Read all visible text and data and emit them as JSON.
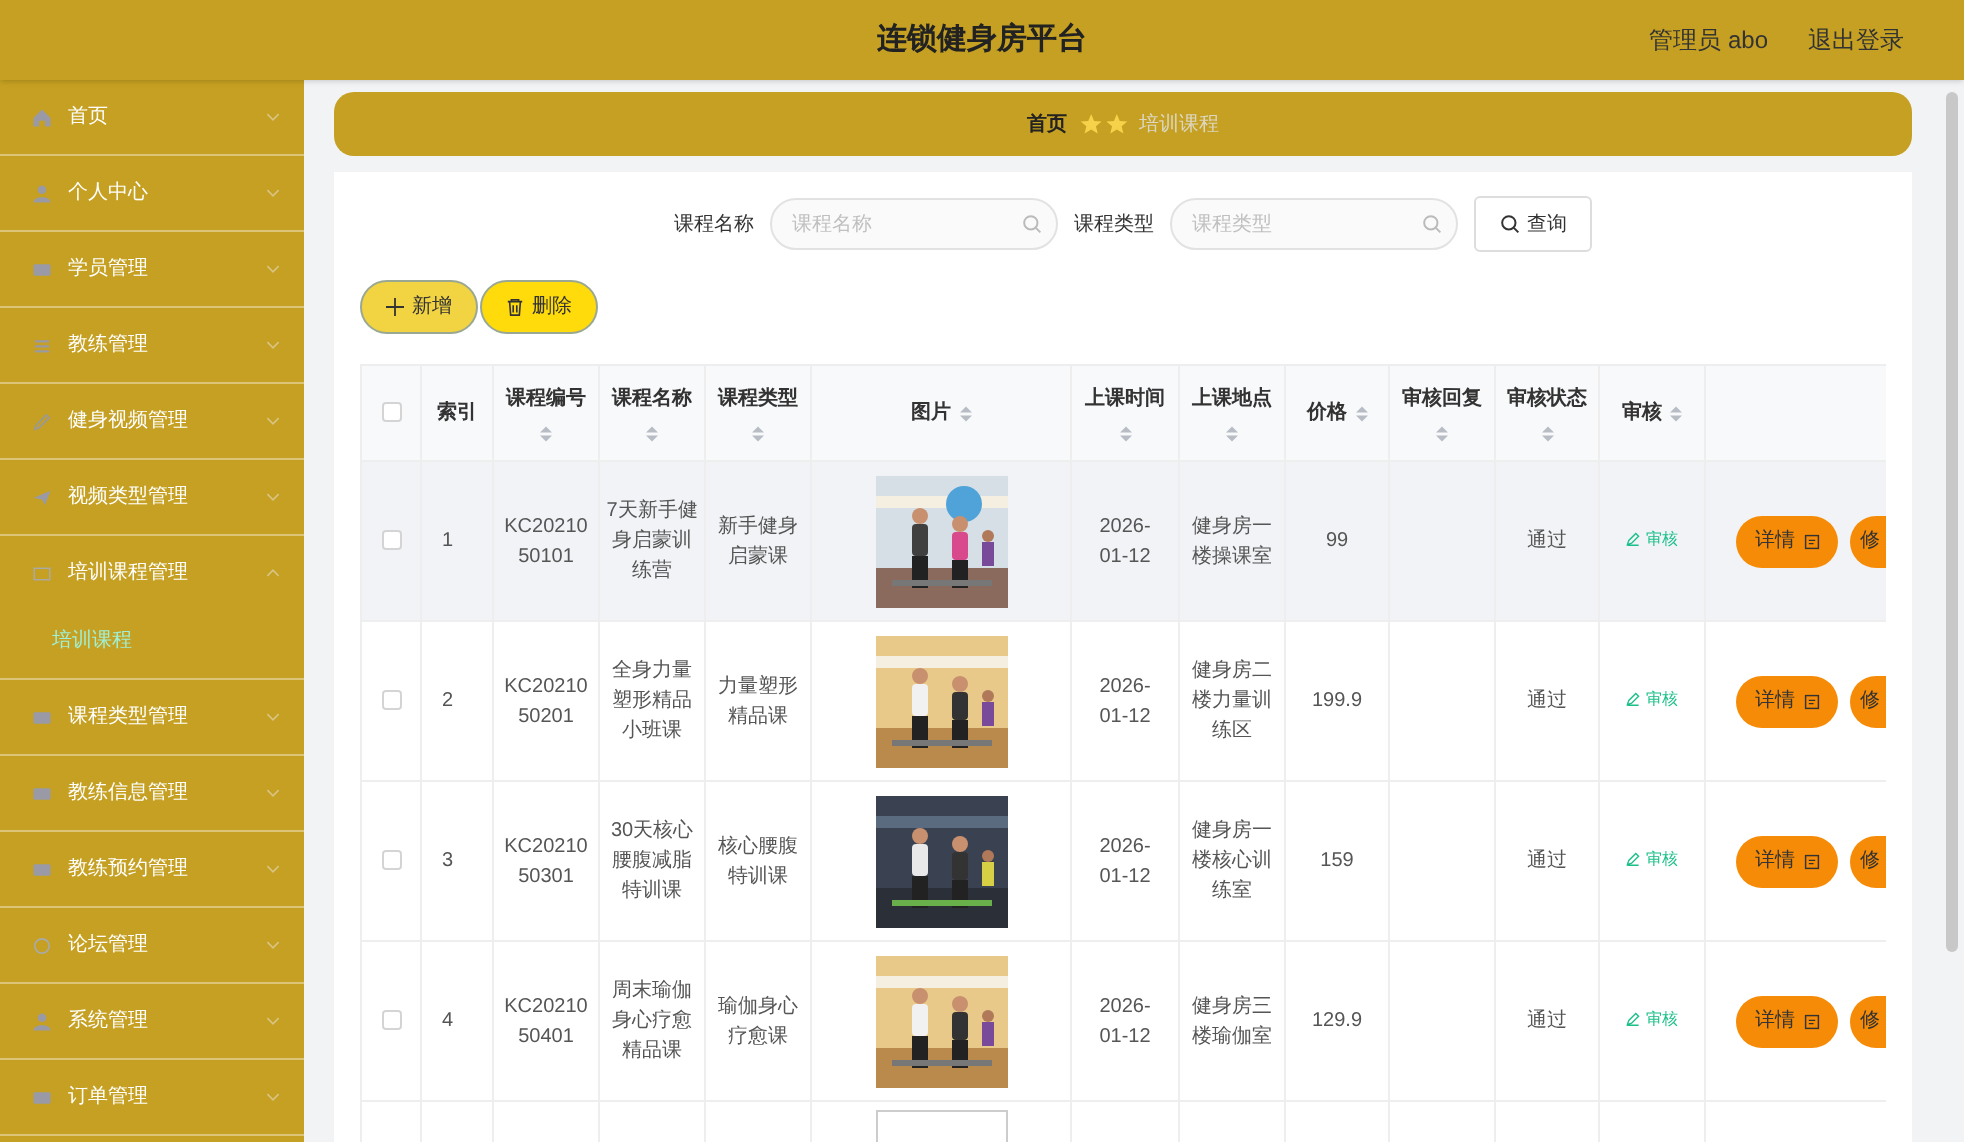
{
  "header": {
    "title": "连锁健身房平台",
    "user": "管理员 abo",
    "logout": "退出登录"
  },
  "sidebar": {
    "items": [
      {
        "label": "首页",
        "expanded": false
      },
      {
        "label": "个人中心",
        "expanded": false
      },
      {
        "label": "学员管理",
        "expanded": false
      },
      {
        "label": "教练管理",
        "expanded": false
      },
      {
        "label": "健身视频管理",
        "expanded": false
      },
      {
        "label": "视频类型管理",
        "expanded": false
      },
      {
        "label": "培训课程管理",
        "expanded": true,
        "children": [
          {
            "label": "培训课程",
            "selected": true
          }
        ]
      },
      {
        "label": "课程类型管理",
        "expanded": false
      },
      {
        "label": "教练信息管理",
        "expanded": false
      },
      {
        "label": "教练预约管理",
        "expanded": false
      },
      {
        "label": "论坛管理",
        "expanded": false
      },
      {
        "label": "系统管理",
        "expanded": false
      },
      {
        "label": "订单管理",
        "expanded": false
      }
    ]
  },
  "breadcrumb": [
    {
      "label": "首页",
      "current": false
    },
    {
      "label": "培训课程",
      "current": true
    }
  ],
  "search": {
    "fields": [
      {
        "label": "课程名称",
        "placeholder": "课程名称"
      },
      {
        "label": "课程类型",
        "placeholder": "课程类型"
      }
    ],
    "button": "查询"
  },
  "actions": [
    {
      "label": "新增",
      "kind": "add"
    },
    {
      "label": "删除",
      "kind": "delete"
    }
  ],
  "table": {
    "all_checked": false,
    "columns": [
      {
        "label": "索引",
        "sortable": false
      },
      {
        "label": "课程编号",
        "sortable": true
      },
      {
        "label": "课程名称",
        "sortable": true
      },
      {
        "label": "课程类型",
        "sortable": true
      },
      {
        "label": "图片",
        "sortable": true
      },
      {
        "label": "上课时间",
        "sortable": true
      },
      {
        "label": "上课地点",
        "sortable": true
      },
      {
        "label": "价格",
        "sortable": true
      },
      {
        "label": "审核回复",
        "sortable": true
      },
      {
        "label": "审核状态",
        "sortable": true
      },
      {
        "label": "审核",
        "sortable": true
      }
    ],
    "rows": [
      {
        "index": "1",
        "code": "KC2021050101",
        "name": "7天新手健身启蒙训练营",
        "type": "新手健身启蒙课",
        "time": "2026-01-12",
        "place": "健身房一楼操课室",
        "price": "99",
        "status": "通过",
        "review": "审核",
        "detail": "详情",
        "edit": "修",
        "hovered": true,
        "checked": false
      },
      {
        "index": "2",
        "code": "KC2021050201",
        "name": "全身力量塑形精品小班课",
        "type": "力量塑形精品课",
        "time": "2026-01-12",
        "place": "健身房二楼力量训练区",
        "price": "199.9",
        "status": "通过",
        "review": "审核",
        "detail": "详情",
        "edit": "修",
        "hovered": false,
        "checked": false
      },
      {
        "index": "3",
        "code": "KC2021050301",
        "name": "30天核心腰腹减脂特训课",
        "type": "核心腰腹特训课",
        "time": "2026-01-12",
        "place": "健身房一楼核心训练室",
        "price": "159",
        "status": "通过",
        "review": "审核",
        "detail": "详情",
        "edit": "修",
        "hovered": false,
        "checked": false
      },
      {
        "index": "4",
        "code": "KC2021050401",
        "name": "周末瑜伽身心疗愈精品课",
        "type": "瑜伽身心疗愈课",
        "time": "2026-01-12",
        "place": "健身房三楼瑜伽室",
        "price": "129.9",
        "status": "通过",
        "review": "审核",
        "detail": "详情",
        "edit": "修",
        "hovered": false,
        "checked": false
      }
    ]
  }
}
